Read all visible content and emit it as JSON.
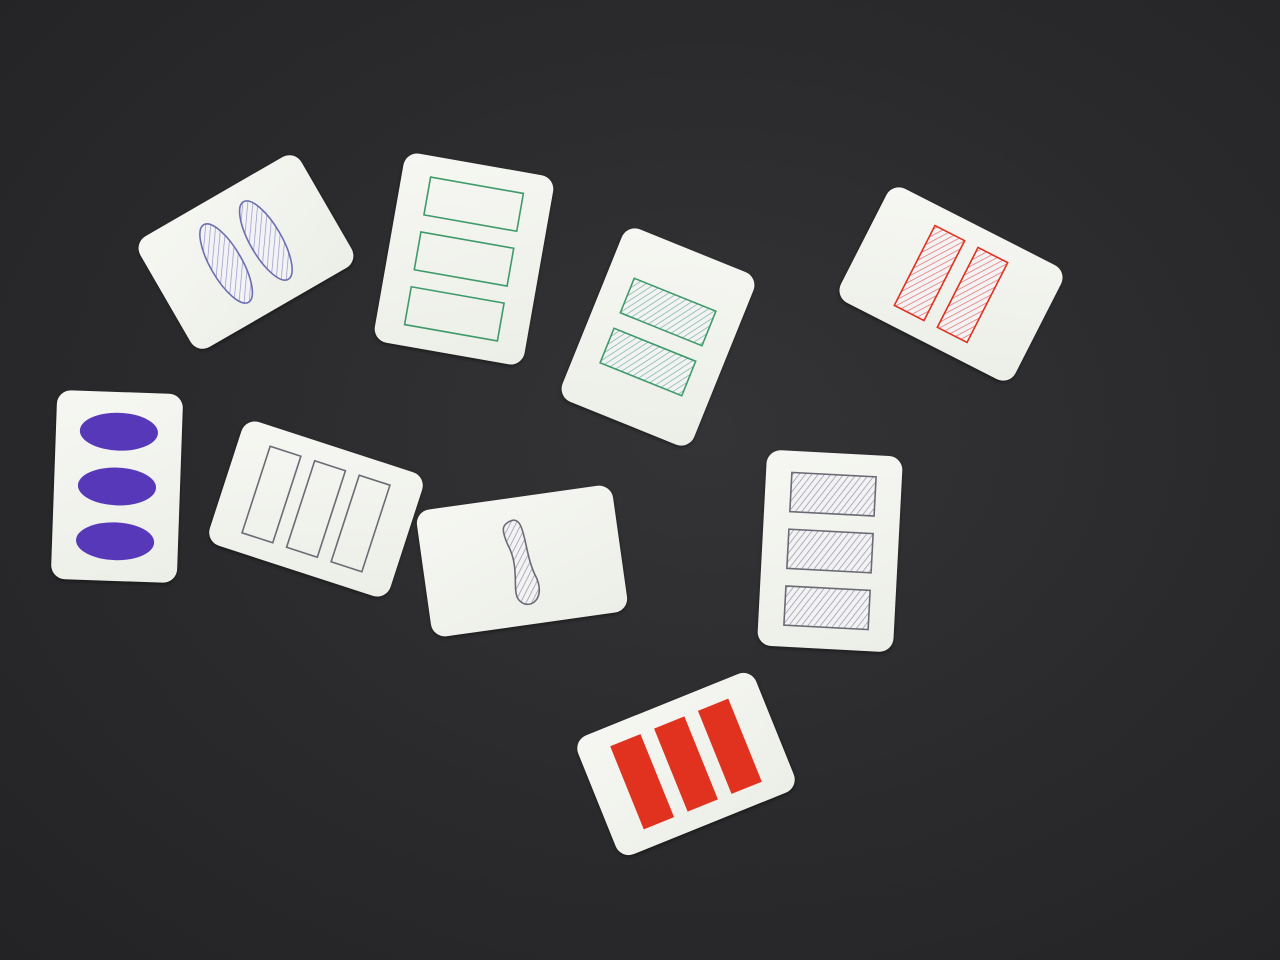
{
  "scene": "set-card-game-table",
  "colors": {
    "table": "#2b2b2d",
    "card": "#f1f2ed",
    "red": "#e0321f",
    "green": "#3f9a6a",
    "purple": "#5638b8",
    "gray": "#6b6b75",
    "blue-gray": "#6c6fb0"
  },
  "cards": [
    {
      "id": "card-two-oval-purple-striped",
      "count": 2,
      "shape": "oval",
      "fill": "striped",
      "color": "blue-gray",
      "orientation": "landscape",
      "rotation_deg": -30
    },
    {
      "id": "card-three-rect-green-open",
      "count": 3,
      "shape": "rectangle",
      "fill": "open",
      "color": "green",
      "orientation": "portrait",
      "rotation_deg": 10
    },
    {
      "id": "card-two-rect-green-striped",
      "count": 2,
      "shape": "rectangle",
      "fill": "striped",
      "color": "green",
      "orientation": "portrait",
      "rotation_deg": 22
    },
    {
      "id": "card-two-rect-red-striped",
      "count": 2,
      "shape": "rectangle",
      "fill": "striped",
      "color": "red",
      "orientation": "landscape",
      "rotation_deg": 27
    },
    {
      "id": "card-three-oval-purple-solid",
      "count": 3,
      "shape": "oval",
      "fill": "solid",
      "color": "purple",
      "orientation": "portrait",
      "rotation_deg": 2
    },
    {
      "id": "card-three-rect-gray-open",
      "count": 3,
      "shape": "rectangle",
      "fill": "open",
      "color": "gray",
      "orientation": "landscape",
      "rotation_deg": 18
    },
    {
      "id": "card-one-squiggle-gray-striped",
      "count": 1,
      "shape": "squiggle",
      "fill": "striped",
      "color": "gray",
      "orientation": "landscape",
      "rotation_deg": -8
    },
    {
      "id": "card-three-rect-gray-striped",
      "count": 3,
      "shape": "rectangle",
      "fill": "striped",
      "color": "gray",
      "orientation": "portrait",
      "rotation_deg": 3
    },
    {
      "id": "card-three-rect-red-solid",
      "count": 3,
      "shape": "rectangle",
      "fill": "solid",
      "color": "red",
      "orientation": "landscape",
      "rotation_deg": -22
    }
  ]
}
